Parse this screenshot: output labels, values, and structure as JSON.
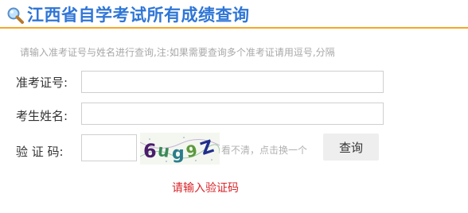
{
  "header": {
    "title": "江西省自学考试所有成绩查询",
    "icon": "magnifier-icon",
    "accent_color": "#2f76d6",
    "rule_color": "#f5a623"
  },
  "form": {
    "hint": "请输入准考证号与姓名进行查询,注:如果需要查询多个准考证请用逗号,分隔",
    "exam_id": {
      "label": "准考证号:",
      "value": "",
      "placeholder": ""
    },
    "name": {
      "label": "考生姓名:",
      "value": "",
      "placeholder": ""
    },
    "captcha": {
      "label": "验 证 码:",
      "value": "",
      "placeholder": "",
      "image_text": "6ug9Z",
      "refresh_text": "看不清，点击换一个"
    },
    "submit_label": "查询",
    "error": "请输入验证码",
    "error_color": "#d8262b"
  }
}
